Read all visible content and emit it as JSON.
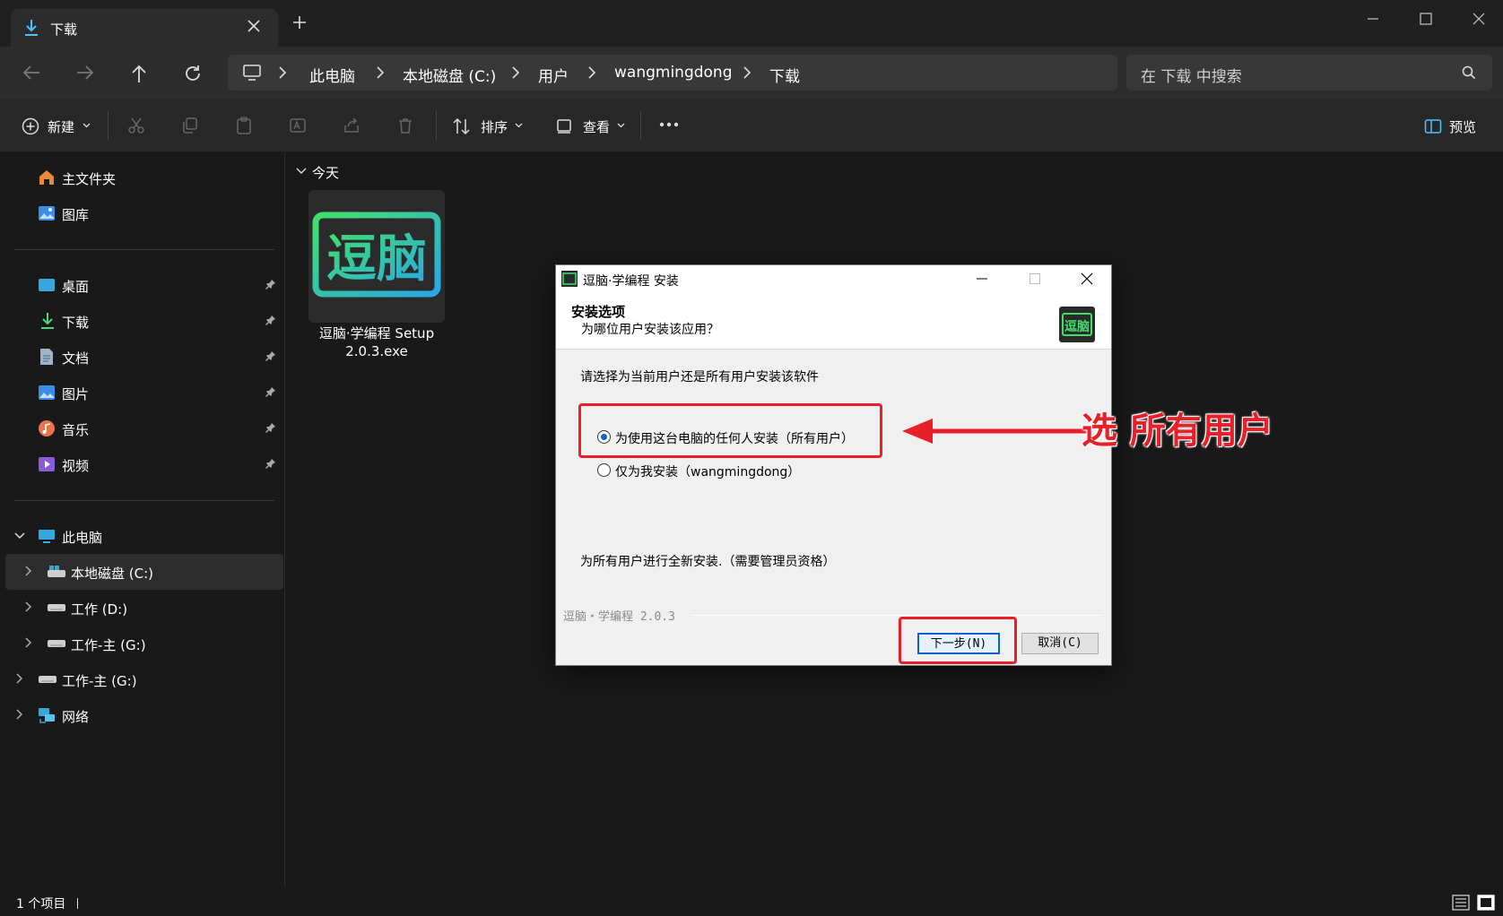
{
  "window": {
    "tab_title": "下载",
    "colors": {
      "accent": "#4cc2ff",
      "annotation": "#e8202a"
    }
  },
  "address_bar": {
    "crumbs": [
      "此电脑",
      "本地磁盘 (C:)",
      "用户",
      "wangmingdong",
      "下载"
    ],
    "search_placeholder": "在 下载 中搜索"
  },
  "toolbar": {
    "new_label": "新建",
    "sort_label": "排序",
    "view_label": "查看",
    "preview_label": "预览"
  },
  "sidebar": {
    "home": "主文件夹",
    "gallery": "图库",
    "quick": [
      {
        "label": "桌面",
        "icon": "desktop-icon"
      },
      {
        "label": "下载",
        "icon": "download-icon"
      },
      {
        "label": "文档",
        "icon": "document-icon"
      },
      {
        "label": "图片",
        "icon": "pictures-icon"
      },
      {
        "label": "音乐",
        "icon": "music-icon"
      },
      {
        "label": "视频",
        "icon": "video-icon"
      }
    ],
    "this_pc": "此电脑",
    "drives": [
      "本地磁盘 (C:)",
      "工作 (D:)",
      "工作-主 (G:)"
    ],
    "extra_drive": "工作-主 (G:)",
    "network": "网络"
  },
  "content": {
    "group_header": "今天",
    "file_name_line1": "逗脑·学编程 Setup",
    "file_name_line2": "2.0.3.exe",
    "logo_text": "逗脑"
  },
  "status": {
    "item_count": "1 个项目"
  },
  "dialog": {
    "title": "逗脑·学编程 安装",
    "heading": "安装选项",
    "subheading": "为哪位用户安装该应用？",
    "prompt": "请选择为当前用户还是所有用户安装该软件",
    "options": [
      {
        "label": "为使用这台电脑的任何人安装（所有用户）",
        "selected": true
      },
      {
        "label": "仅为我安装（wangmingdong）",
        "selected": false
      }
    ],
    "note": "为所有用户进行全新安装.（需要管理员资格）",
    "version": "逗脑・学编程 2.0.3",
    "next_button": "下一步(N)",
    "cancel_button": "取消(C)",
    "logo_text": "逗脑"
  },
  "annotation": {
    "text": "选 所有用户"
  }
}
